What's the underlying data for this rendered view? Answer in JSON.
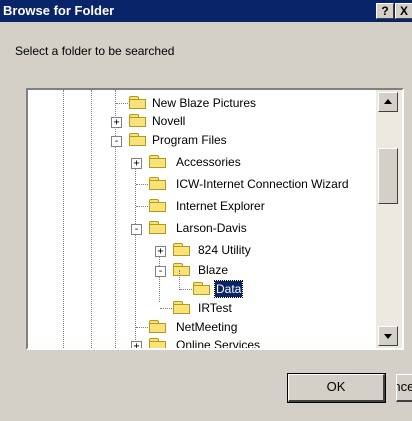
{
  "window": {
    "title": "Browse for Folder",
    "help_label": "?",
    "close_label": "X"
  },
  "instruction": "Select a folder to be searched",
  "tree": {
    "items": [
      {
        "label": "New Blaze Pictures",
        "toggle": ""
      },
      {
        "label": "Novell",
        "toggle": "+"
      },
      {
        "label": "Program Files",
        "toggle": "-"
      },
      {
        "label": "Accessories",
        "toggle": "+"
      },
      {
        "label": "ICW-Internet Connection Wizard",
        "toggle": ""
      },
      {
        "label": "Internet Explorer",
        "toggle": ""
      },
      {
        "label": "Larson-Davis",
        "toggle": "-"
      },
      {
        "label": "824 Utility",
        "toggle": "+"
      },
      {
        "label": "Blaze",
        "toggle": "-"
      },
      {
        "label": "Data",
        "toggle": "",
        "selected": true
      },
      {
        "label": "IRTest",
        "toggle": ""
      },
      {
        "label": "NetMeeting",
        "toggle": ""
      },
      {
        "label": "Online Services",
        "toggle": "+"
      }
    ]
  },
  "buttons": {
    "ok": "OK",
    "cancel": "Cancel"
  },
  "colors": {
    "titlebar": "#0a246a",
    "face": "#d4d0c8",
    "selection": "#0a246a",
    "folder": "#f7e37a"
  }
}
